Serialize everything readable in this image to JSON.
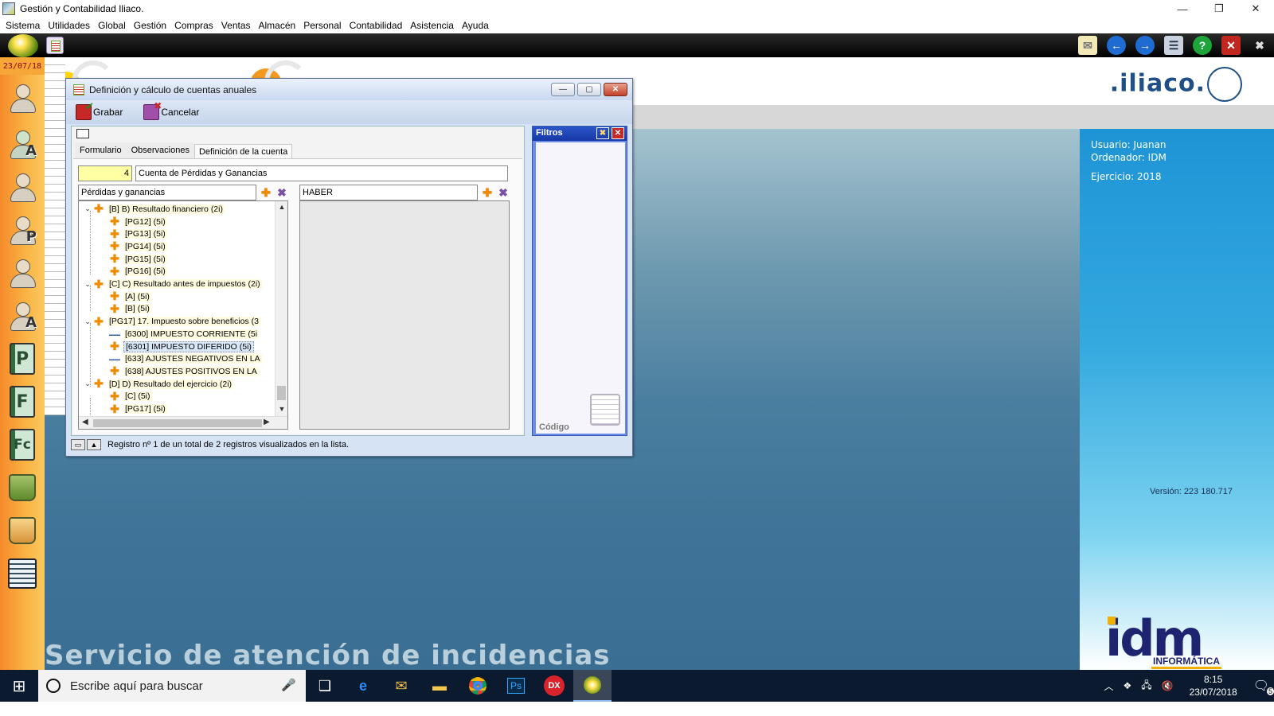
{
  "window": {
    "title": "Gestión y Contabilidad Iliaco.",
    "controls": [
      "—",
      "❐",
      "✕"
    ]
  },
  "menu": [
    "Sistema",
    "Utilidades",
    "Global",
    "Gestión",
    "Compras",
    "Ventas",
    "Almacén",
    "Personal",
    "Contabilidad",
    "Asistencia",
    "Ayuda"
  ],
  "left_dock": {
    "date": "23/07/18",
    "letters": {
      "a1": "A",
      "p1": "P",
      "a2": "A",
      "book_p": "P",
      "book_f": "F",
      "book_fc": "Fc"
    }
  },
  "logo": {
    "iliaco": ".iliaco."
  },
  "info_panel": {
    "usuario": "Usuario: Juanan",
    "ordenador": "Ordenador: IDM",
    "ejercicio": "Ejercicio: 2018",
    "version": "Versión: 223 180.717",
    "idm_text": "idm",
    "idm_sub": "INFORMÁTICA"
  },
  "background": {
    "slogan": "Servicio de atención de incidencias"
  },
  "dialog": {
    "title": "Definición y cálculo de cuentas anuales",
    "toolbar": {
      "save": "Grabar",
      "cancel": "Cancelar"
    },
    "tabs": [
      "Formulario",
      "Observaciones",
      "Definición de la cuenta"
    ],
    "active_tab": "Definición de la cuenta",
    "account_number": "4",
    "account_name": "Cuenta de Pérdidas y Ganancias",
    "left_header": "Pérdidas y ganancias",
    "right_header": "HABER",
    "tree": [
      {
        "level": 0,
        "expand": "v",
        "icon": "plus",
        "label": "[B] B) Resultado financiero (2i)"
      },
      {
        "level": 1,
        "icon": "plus",
        "label": "[PG12] (5i)"
      },
      {
        "level": 1,
        "icon": "plus",
        "label": "[PG13] (5i)"
      },
      {
        "level": 1,
        "icon": "plus",
        "label": "[PG14] (5i)"
      },
      {
        "level": 1,
        "icon": "plus",
        "label": "[PG15] (5i)"
      },
      {
        "level": 1,
        "icon": "plus",
        "label": "[PG16] (5i)"
      },
      {
        "level": 0,
        "expand": "v",
        "icon": "plus",
        "label": "[C] C) Resultado antes de impuestos (2i)"
      },
      {
        "level": 1,
        "icon": "plus",
        "label": "[A] (5i)"
      },
      {
        "level": 1,
        "icon": "plus",
        "label": "[B] (5i)"
      },
      {
        "level": 0,
        "expand": "v",
        "icon": "plus",
        "label": "[PG17] 17. Impuesto sobre beneficios (3"
      },
      {
        "level": 1,
        "icon": "minus",
        "label": "[6300] IMPUESTO CORRIENTE (5i"
      },
      {
        "level": 1,
        "icon": "plus",
        "label": "[6301] IMPUESTO DIFERIDO (5i)",
        "selected": true
      },
      {
        "level": 1,
        "icon": "minus",
        "label": "[633] AJUSTES NEGATIVOS EN LA"
      },
      {
        "level": 1,
        "icon": "plus",
        "label": "[638] AJUSTES POSITIVOS EN LA"
      },
      {
        "level": 0,
        "expand": "v",
        "icon": "plus",
        "label": "[D] D) Resultado del ejercicio (2i)"
      },
      {
        "level": 1,
        "icon": "plus",
        "label": "[C] (5i)"
      },
      {
        "level": 1,
        "icon": "plus",
        "label": "[PG17] (5i)"
      }
    ],
    "filters": {
      "title": "Filtros",
      "field": "Código"
    },
    "status": "Registro nº 1 de un total de 2 registros visualizados en la lista."
  },
  "taskbar": {
    "search_placeholder": "Escribe aquí para buscar",
    "apps": [
      "task-view",
      "edge",
      "mail",
      "explorer",
      "chrome",
      "photoshop",
      "dx",
      "iliaco"
    ],
    "app_labels": {
      "photoshop": "Ps",
      "dx": "DX"
    },
    "time": "8:15",
    "date": "23/07/2018",
    "notifications": "5"
  },
  "colors": {
    "accent_blue": "#1e94d6",
    "dialog_bg": "#d6e3f5",
    "orange_dock": "#f58a2a",
    "yellow_field": "#ffffa3"
  }
}
